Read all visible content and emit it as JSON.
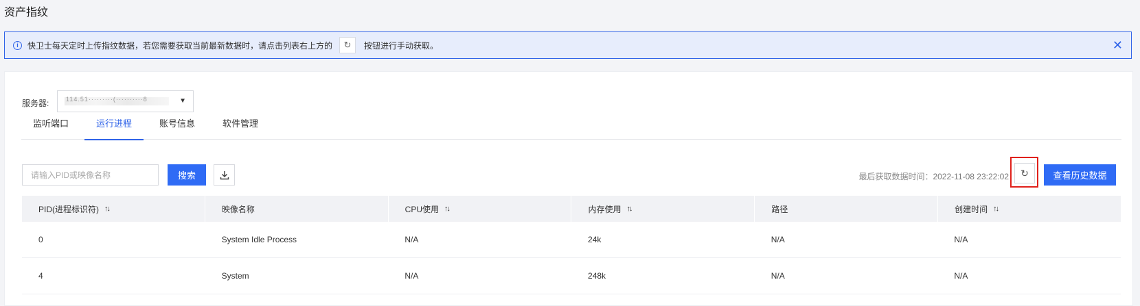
{
  "page": {
    "title": "资产指纹"
  },
  "notice": {
    "text_before": "快卫士每天定时上传指纹数据，若您需要获取当前最新数据时，请点击列表右上方的",
    "text_after": "按钮进行手动获取。",
    "info_icon": "ⓘ",
    "refresh_icon": "↻",
    "close_icon": "✕"
  },
  "filters": {
    "server_label": "服务器:",
    "server_value": "114.51·········(··········8"
  },
  "tabs": [
    {
      "label": "监听端口"
    },
    {
      "label": "运行进程"
    },
    {
      "label": "账号信息"
    },
    {
      "label": "软件管理"
    }
  ],
  "toolbar": {
    "search_placeholder": "请输入PID或映像名称",
    "search_label": "搜索",
    "last_fetch_label": "最后获取数据时间：",
    "last_fetch_time": "2022-11-08 23:22:02",
    "history_label": "查看历史数据",
    "refresh_icon": "↻"
  },
  "table": {
    "columns": [
      {
        "label": "PID(进程标识符)",
        "sortable": true
      },
      {
        "label": "映像名称",
        "sortable": false
      },
      {
        "label": "CPU使用",
        "sortable": true
      },
      {
        "label": "内存使用",
        "sortable": true
      },
      {
        "label": "路径",
        "sortable": false
      },
      {
        "label": "创建时间",
        "sortable": true
      }
    ],
    "sort_icon": "↑↓",
    "rows": [
      [
        "0",
        "System Idle Process",
        "N/A",
        "24k",
        "N/A",
        "N/A"
      ],
      [
        "4",
        "System",
        "N/A",
        "248k",
        "N/A",
        "N/A"
      ]
    ]
  },
  "colors": {
    "accent": "#2f6bf5",
    "highlight_border": "#e0201a",
    "notice_bg": "#e7edfc"
  }
}
